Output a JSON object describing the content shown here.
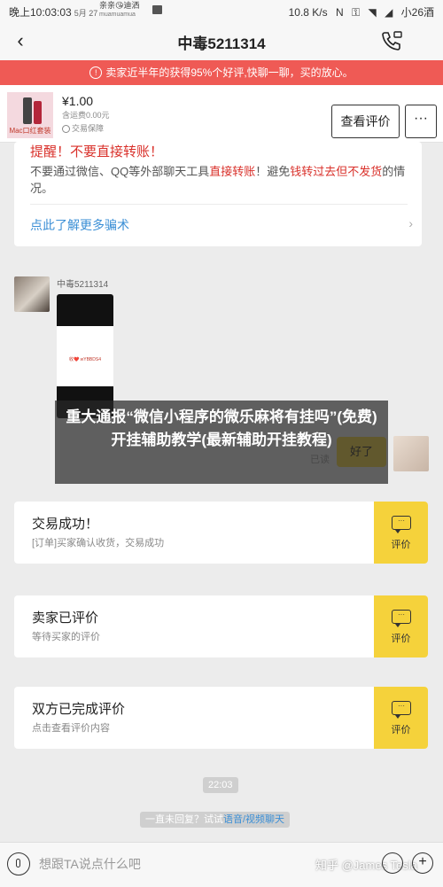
{
  "status_bar": {
    "time": "晚上10:03:03",
    "date": "5月 27",
    "notification": "亲亲😘迪洒",
    "notification_sub": "muamuamua",
    "speed": "10.8 K/s",
    "carrier": "小26酒"
  },
  "nav": {
    "title": "中毒5211314"
  },
  "banner": {
    "icon": "!",
    "text": "卖家近半年的获得95%个好评,快聊一聊，买的放心。"
  },
  "product": {
    "thumb_label": "Mac口红套装",
    "price": "¥1.00",
    "shipping": "含运费0.00元",
    "protection": "交易保障",
    "review_button": "查看评价",
    "more_button": "···"
  },
  "scam_warning": {
    "title": "提醒！不要直接转账！",
    "body_a": "不要通过微信、QQ等外部聊天工具",
    "body_red_a": "直接转账",
    "body_b": "！避免",
    "body_red_b": "钱转过去但不发货",
    "body_c": "的情况。",
    "link": "点此了解更多骗术",
    "arrow": "›"
  },
  "chat": {
    "sender_name": "中毒5211314",
    "screenshot_text": "收❤️ wYBBDS4",
    "overlay_text": "重大通报“微信小程序的微乐麻将有挂吗”(免费)开挂辅助教学(最新辅助开挂教程)",
    "read_label": "已读",
    "reply_text": "好了"
  },
  "cards": [
    {
      "title": "交易成功！",
      "subtitle": "[订单]买家确认收货，交易成功",
      "action": "评价",
      "icon": "···"
    },
    {
      "title": "卖家已评价",
      "subtitle": "等待买家的评价",
      "action": "评价",
      "icon": "···"
    },
    {
      "title": "双方已完成评价",
      "subtitle": "点击查看评价内容",
      "action": "评价",
      "icon": "···"
    }
  ],
  "timestamp": "22:03",
  "hint": {
    "text": "一直未回复？试试",
    "link": "语音/视频聊天"
  },
  "input": {
    "placeholder": "想跟TA说点什么吧"
  },
  "watermark": "知乎 @James Tesla"
}
